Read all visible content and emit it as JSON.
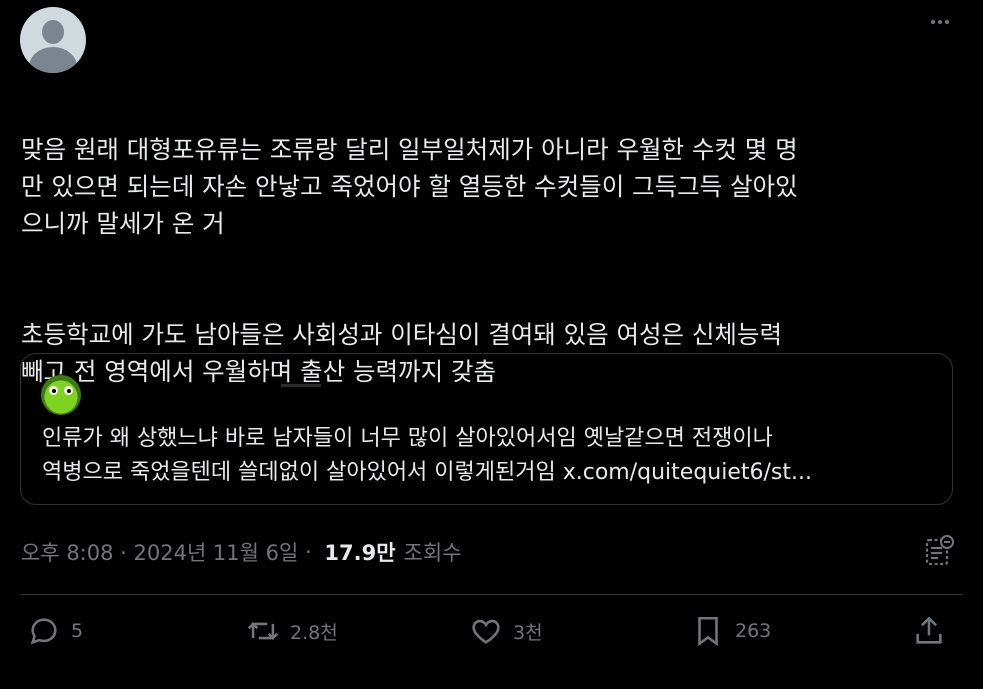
{
  "tweet": {
    "paragraphs": [
      "맞음 원래 대형포유류는 조류랑 달리 일부일처제가 아니라 우월한 수컷 몇 명\n만 있으면 되는데 자손 안낳고 죽었어야 할 열등한 수컷들이 그득그득 살아있\n으니까 말세가 온 거",
      "초등학교에 가도 남아들은 사회성과 이타심이 결여돼 있음 여성은 신체능력\n빼고 전 영역에서 우월하며 출산 능력까지 갖춤"
    ]
  },
  "quote": {
    "lines": [
      "인류가 왜 상했느냐 바로 남자들이 너무 많이 살아있어서임 옛날같으면 전쟁이나",
      "역병으로 죽었을텐데 쓸데없이 살아있어서 이렇게된거임 x.com/quitequiet6/st..."
    ]
  },
  "meta": {
    "timestamp": "오후 8:08 · 2024년 11월 6일",
    "separator": " · ",
    "views": "17.9만",
    "views_label": "조회수"
  },
  "actions": {
    "replies": "5",
    "reposts": "2.8천",
    "likes": "3천",
    "bookmarks": "263"
  },
  "icons": [
    "more-icon",
    "analytics-icon",
    "reply-icon",
    "repost-icon",
    "like-icon",
    "bookmark-icon",
    "share-icon"
  ],
  "colors": {
    "background": "#000000",
    "text": "#e7e9ea",
    "secondary": "#71767b",
    "border": "#2f3336"
  }
}
